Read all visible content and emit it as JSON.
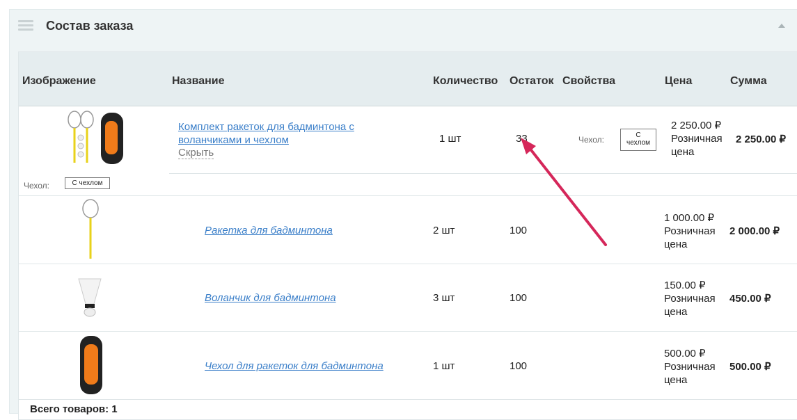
{
  "panel": {
    "title": "Состав заказа"
  },
  "columns": [
    "Изображение",
    "Название",
    "Количество",
    "Остаток",
    "Свойства",
    "Цена",
    "Сумма"
  ],
  "bundle": {
    "name_line1": "Комплект ракеток для бадминтона с",
    "name_line2": "воланчиками и чехлом",
    "hide_link": "Скрыть",
    "qty": "1 шт",
    "stock": "33",
    "prop_label": "Чехол:",
    "prop_value_line1": "С",
    "prop_value_line2": "чехлом",
    "price": "2 250.00 ₽",
    "price_type1": "Розничная",
    "price_type2": "цена",
    "sum": "2 250.00 ₽",
    "image_prop_label": "Чехол:",
    "image_prop_value": "С чехлом"
  },
  "items": [
    {
      "name": "Ракетка для бадминтона",
      "qty": "2 шт",
      "stock": "100",
      "price": "1 000.00 ₽",
      "price_type1": "Розничная",
      "price_type2": "цена",
      "sum": "2 000.00 ₽",
      "icon": "racket-image"
    },
    {
      "name": "Воланчик для бадминтона",
      "qty": "3 шт",
      "stock": "100",
      "price": "150.00 ₽",
      "price_type1": "Розничная",
      "price_type2": "цена",
      "sum": "450.00 ₽",
      "icon": "shuttlecock-image"
    },
    {
      "name": "Чехол для ракеток для бадминтона",
      "qty": "1 шт",
      "stock": "100",
      "price": "500.00 ₽",
      "price_type1": "Розничная",
      "price_type2": "цена",
      "sum": "500.00 ₽",
      "icon": "bag-image"
    }
  ],
  "footer": {
    "total": "Всего товаров: 1"
  },
  "colors": {
    "header_bg": "#e5edef",
    "link": "#3b7fc9",
    "arrow": "#d5275a"
  }
}
